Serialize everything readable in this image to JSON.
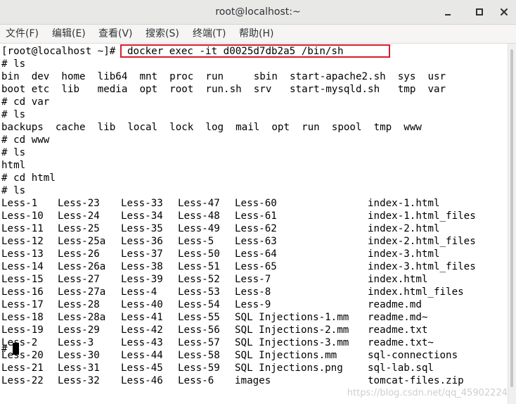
{
  "window": {
    "title": "root@localhost:~",
    "minimize_icon": "minimize-icon",
    "maximize_icon": "maximize-icon",
    "close_icon": "close-icon"
  },
  "menu": {
    "items": [
      "文件(F)",
      "编辑(E)",
      "查看(V)",
      "搜索(S)",
      "终端(T)",
      "帮助(H)"
    ]
  },
  "terminal": {
    "prompt_line": {
      "prompt": "[root@localhost ~]#",
      "command": "docker exec -it d0025d7db2a5 /bin/sh"
    },
    "lines": [
      "# ls",
      "bin  dev  home  lib64  mnt  proc  run     sbin  start-apache2.sh  sys  usr",
      "boot etc  lib   media  opt  root  run.sh  srv   start-mysqld.sh   tmp  var",
      "# cd var",
      "# ls",
      "backups  cache  lib  local  lock  log  mail  opt  run  spool  tmp  www",
      "# cd www",
      "# ls",
      "html",
      "# cd html",
      "# ls"
    ],
    "listing": [
      [
        "Less-1",
        "Less-23",
        "Less-33",
        "Less-47",
        "Less-60",
        "index-1.html"
      ],
      [
        "Less-10",
        "Less-24",
        "Less-34",
        "Less-48",
        "Less-61",
        "index-1.html_files"
      ],
      [
        "Less-11",
        "Less-25",
        "Less-35",
        "Less-49",
        "Less-62",
        "index-2.html"
      ],
      [
        "Less-12",
        "Less-25a",
        "Less-36",
        "Less-5",
        "Less-63",
        "index-2.html_files"
      ],
      [
        "Less-13",
        "Less-26",
        "Less-37",
        "Less-50",
        "Less-64",
        "index-3.html"
      ],
      [
        "Less-14",
        "Less-26a",
        "Less-38",
        "Less-51",
        "Less-65",
        "index-3.html_files"
      ],
      [
        "Less-15",
        "Less-27",
        "Less-39",
        "Less-52",
        "Less-7",
        "index.html"
      ],
      [
        "Less-16",
        "Less-27a",
        "Less-4",
        "Less-53",
        "Less-8",
        "index.html_files"
      ],
      [
        "Less-17",
        "Less-28",
        "Less-40",
        "Less-54",
        "Less-9",
        "readme.md"
      ],
      [
        "Less-18",
        "Less-28a",
        "Less-41",
        "Less-55",
        "SQL Injections-1.mm",
        "readme.md~"
      ],
      [
        "Less-19",
        "Less-29",
        "Less-42",
        "Less-56",
        "SQL Injections-2.mm",
        "readme.txt"
      ],
      [
        "Less-2",
        "Less-3",
        "Less-43",
        "Less-57",
        "SQL Injections-3.mm",
        "readme.txt~"
      ],
      [
        "Less-20",
        "Less-30",
        "Less-44",
        "Less-58",
        "SQL Injections.mm",
        "sql-connections"
      ],
      [
        "Less-21",
        "Less-31",
        "Less-45",
        "Less-59",
        "SQL Injections.png",
        "sql-lab.sql"
      ],
      [
        "Less-22",
        "Less-32",
        "Less-46",
        "Less-6",
        "images",
        "tomcat-files.zip"
      ]
    ],
    "final_prompt": "#"
  },
  "watermark": "https://blog.csdn.net/qq_45902224",
  "colors": {
    "highlight": "#d81e2c",
    "titlebar": "#e8e8e7",
    "text": "#000000"
  }
}
